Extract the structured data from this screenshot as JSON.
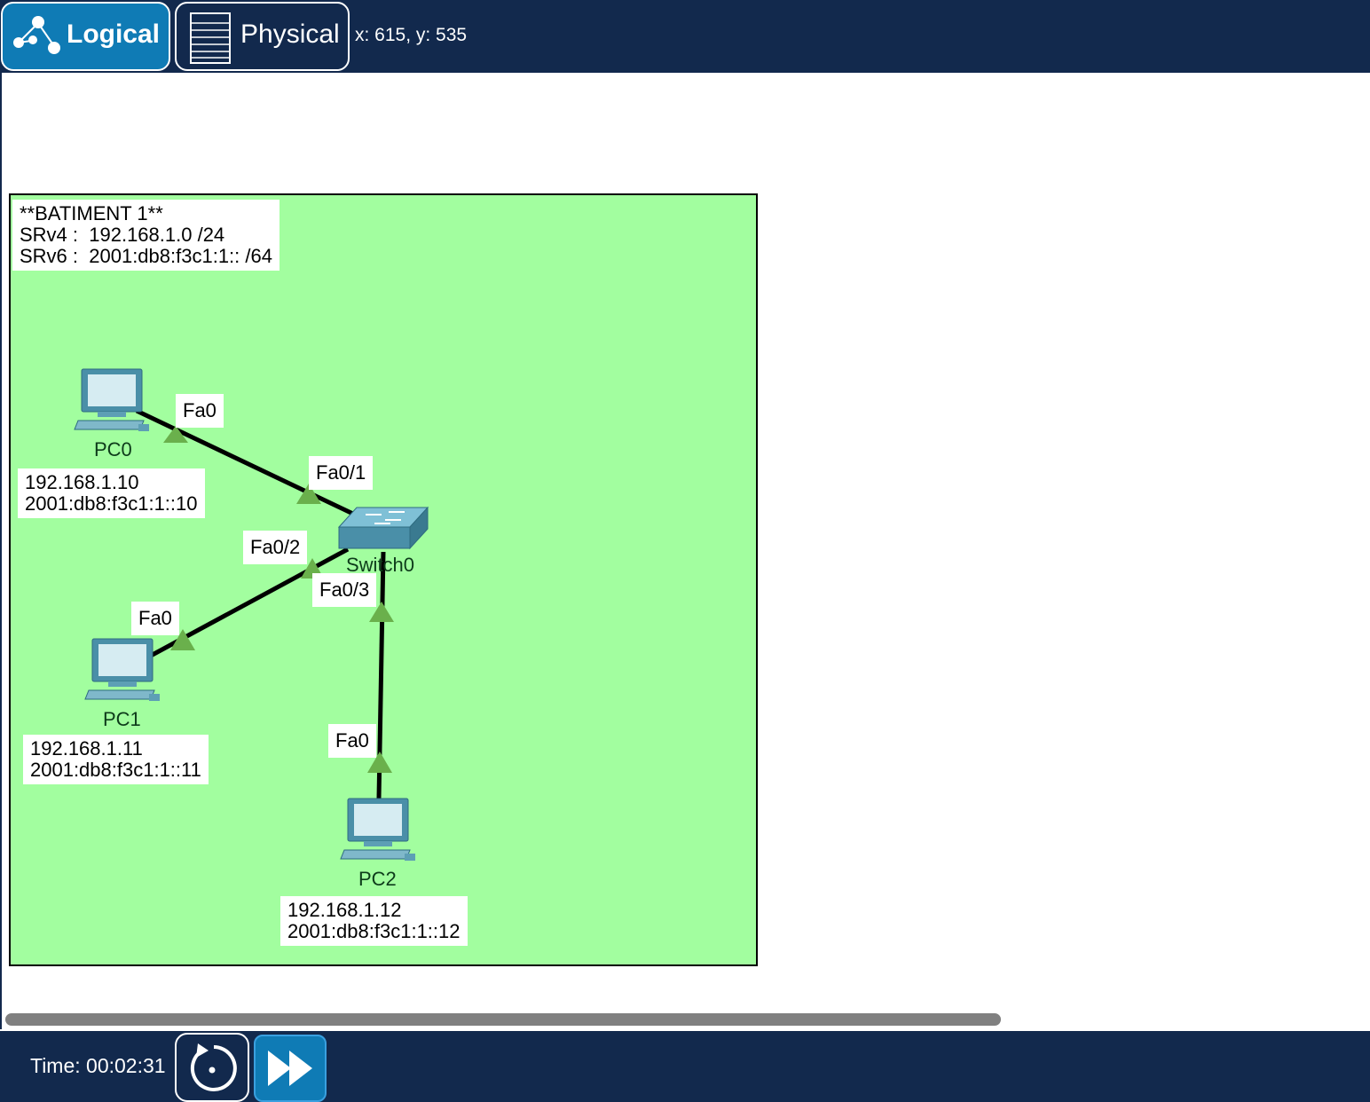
{
  "header": {
    "tabs": [
      {
        "label": "Logical",
        "icon": "logical-topology-icon",
        "active": true
      },
      {
        "label": "Physical",
        "icon": "rack-icon",
        "active": false
      }
    ],
    "cursor_coords": "x: 615, y: 535"
  },
  "colors": {
    "bar_bg": "#12294d",
    "active_tab": "#0f7bb5",
    "area_bg": "#a2fe9f",
    "link_up": "#6ab04c"
  },
  "diagram": {
    "area_note": "**BATIMENT 1**\nSRv4 :  192.168.1.0 /24\nSRv6 :  2001:db8:f3c1:1:: /64",
    "devices": [
      {
        "name": "PC0",
        "type": "pc-icon",
        "note": "192.168.1.10\n2001:db8:f3c1:1::10"
      },
      {
        "name": "PC1",
        "type": "pc-icon",
        "note": "192.168.1.11\n2001:db8:f3c1:1::11"
      },
      {
        "name": "PC2",
        "type": "pc-icon",
        "note": "192.168.1.12\n2001:db8:f3c1:1::12"
      },
      {
        "name": "Switch0",
        "type": "switch-icon"
      }
    ],
    "ports": {
      "pc0": "Fa0",
      "sw_pc0": "Fa0/1",
      "sw_pc1": "Fa0/2",
      "pc1": "Fa0",
      "sw_pc2": "Fa0/3",
      "pc2": "Fa0"
    }
  },
  "footer": {
    "time": "Time: 00:02:31",
    "reset_icon": "reset-clock-icon",
    "fast_forward_icon": "fast-forward-icon"
  }
}
